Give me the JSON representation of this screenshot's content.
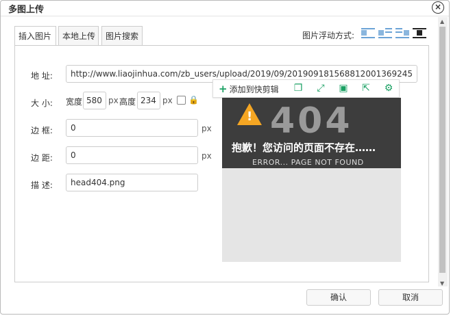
{
  "dialog": {
    "title": "多图上传",
    "close_glyph": "×"
  },
  "tabs": [
    {
      "label": "插入图片",
      "active": true
    },
    {
      "label": "本地上传",
      "active": false
    },
    {
      "label": "图片搜索",
      "active": false
    }
  ],
  "float": {
    "label": "图片浮动方式:",
    "options": [
      "none-icon",
      "left-icon",
      "right-icon",
      "center-icon"
    ],
    "selected": "center-icon"
  },
  "form": {
    "address_label": "地 址:",
    "address_value": "http://www.liaojinhua.com/zb_users/upload/2019/09/201909181568812001369245",
    "size_label": "大 小:",
    "width_label": "宽度",
    "width_value": "580",
    "height_label": "高度",
    "height_value": "234",
    "px": "px",
    "border_label": "边 框:",
    "border_value": "0",
    "margin_label": "边 距:",
    "margin_value": "0",
    "desc_label": "描 述:",
    "desc_value": "head404.png"
  },
  "toolbar": {
    "add_label": "添加到快剪辑",
    "icons": [
      "copy-icon",
      "fullscreen-icon",
      "save-icon",
      "share-icon",
      "settings-icon"
    ]
  },
  "preview": {
    "big_text": "404",
    "cn_text": "抱歉！您访问的页面不存在……",
    "en_text": "ERROR... PAGE NOT FOUND"
  },
  "buttons": {
    "ok": "确认",
    "cancel": "取消"
  },
  "colors": {
    "accent_green": "#1aa063",
    "banner_bg": "#3d3d3d",
    "warning": "#f5a623"
  }
}
